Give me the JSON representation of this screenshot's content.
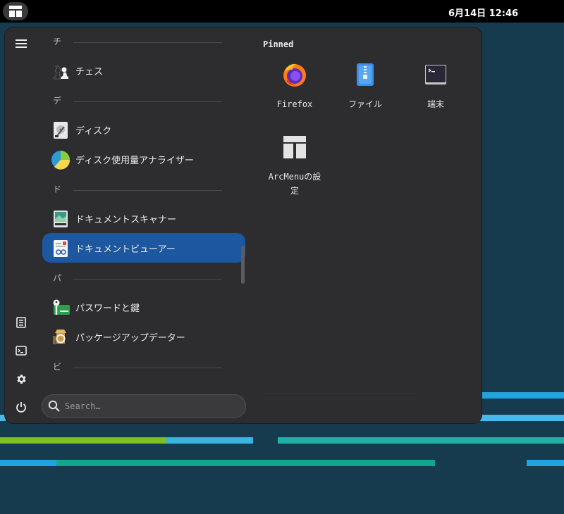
{
  "topbar": {
    "clock": "6月14日  12:46",
    "menu_icon": "layout-icon"
  },
  "sidebar": {
    "icons": [
      "hamburger-icon",
      "document-icon",
      "terminal-icon",
      "gear-icon",
      "power-icon"
    ]
  },
  "apps": {
    "sections": [
      {
        "letter": "チ"
      },
      {
        "letter": "デ"
      },
      {
        "letter": "ド"
      },
      {
        "letter": "パ"
      },
      {
        "letter": "ビ"
      }
    ],
    "items": [
      {
        "label": "チェス",
        "icon": "chess-icon"
      },
      {
        "label": "ディスク",
        "icon": "disk-icon"
      },
      {
        "label": "ディスク使用量アナライザー",
        "icon": "pie-chart-icon"
      },
      {
        "label": "ドキュメントスキャナー",
        "icon": "scanner-icon"
      },
      {
        "label": "ドキュメントビューアー",
        "icon": "document-viewer-icon",
        "selected": true
      },
      {
        "label": "パスワードと鍵",
        "icon": "key-icon"
      },
      {
        "label": "パッケージアップデーター",
        "icon": "package-icon"
      }
    ]
  },
  "search": {
    "placeholder": "Search…",
    "value": ""
  },
  "pinned": {
    "title": "Pinned",
    "items": [
      {
        "label": "Firefox",
        "icon": "firefox-icon"
      },
      {
        "label": "ファイル",
        "icon": "files-icon"
      },
      {
        "label": "端末",
        "icon": "terminal-icon"
      },
      {
        "label": "ArcMenuの設定",
        "icon": "arcmenu-settings-icon"
      }
    ]
  },
  "colors": {
    "panel_bg": "#2d2d2f",
    "selected_row": "#1c57a0",
    "wallpaper": "#163a4e"
  }
}
